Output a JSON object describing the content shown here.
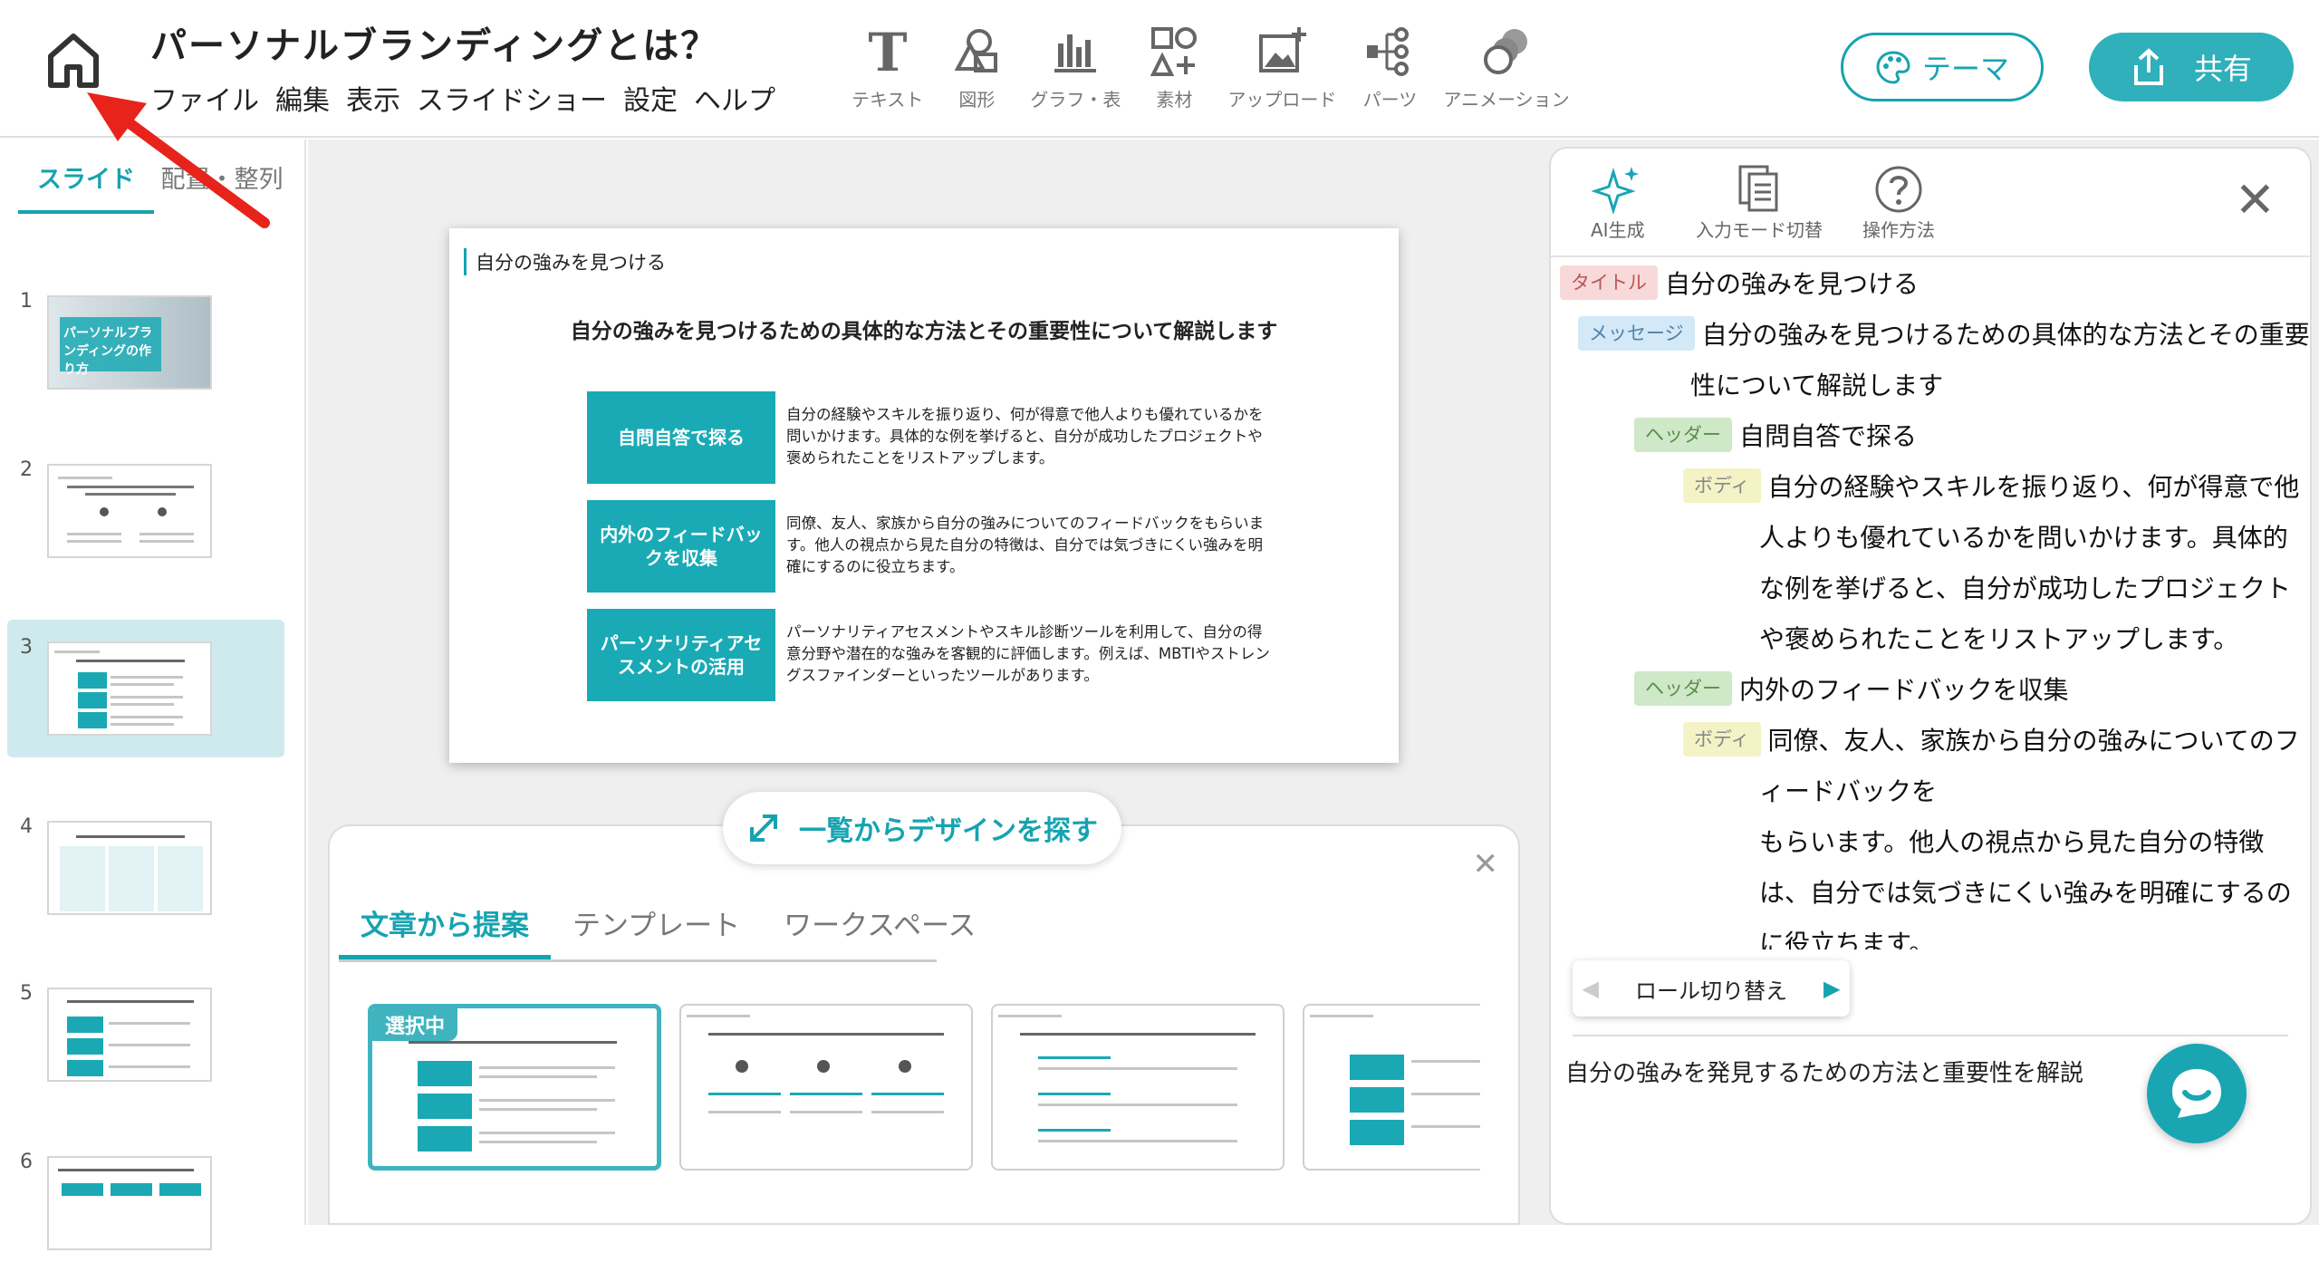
{
  "app": {
    "title": "パーソナルブランディングとは？",
    "menu": [
      "ファイル",
      "編集",
      "表示",
      "スライドショー",
      "設定",
      "ヘルプ"
    ]
  },
  "toolbar": {
    "tools": [
      {
        "label": "テキスト",
        "icon": "text-icon"
      },
      {
        "label": "図形",
        "icon": "shape-icon"
      },
      {
        "label": "グラフ・表",
        "icon": "chart-icon"
      },
      {
        "label": "素材",
        "icon": "material-icon"
      },
      {
        "label": "アップロード",
        "icon": "upload-icon"
      },
      {
        "label": "パーツ",
        "icon": "parts-icon"
      },
      {
        "label": "アニメーション",
        "icon": "animation-icon"
      }
    ],
    "theme_label": "テーマ",
    "share_label": "共有"
  },
  "sidebar": {
    "tabs": [
      "スライド",
      "配置・整列"
    ],
    "thumbs": [
      {
        "num": "1",
        "text": "パーソナルブランディングの作り方"
      },
      {
        "num": "2"
      },
      {
        "num": "3"
      },
      {
        "num": "4"
      },
      {
        "num": "5"
      },
      {
        "num": "6"
      }
    ]
  },
  "slide": {
    "title": "自分の強みを見つける",
    "message": "自分の強みを見つけるための具体的な方法とその重要性について解説します",
    "items": [
      {
        "header": "自問自答で探る",
        "body": "自分の経験やスキルを振り返り、何が得意で他人よりも優れているかを問いかけます。具体的な例を挙げると、自分が成功したプロジェクトや褒められたことをリストアップします。"
      },
      {
        "header": "内外のフィードバックを収集",
        "body": "同僚、友人、家族から自分の強みについてのフィードバックをもらいます。他人の視点から見た自分の特徴は、自分では気づきにくい強みを明確にするのに役立ちます。"
      },
      {
        "header": "パーソナリティアセスメントの活用",
        "body": "パーソナリティアセスメントやスキル診断ツールを利用して、自分の得意分野や潜在的な強みを客観的に評価します。例えば、MBTIやストレングスファインダーといったツールがあります。"
      }
    ]
  },
  "design_panel": {
    "find_label": "一覧からデザインを探す",
    "tabs": [
      "文章から提案",
      "テンプレート",
      "ワークスペース"
    ],
    "selected_badge": "選択中"
  },
  "right_panel": {
    "tools": [
      "AI生成",
      "入力モード切替",
      "操作方法"
    ],
    "roles": {
      "title": "タイトル",
      "message": "メッセージ",
      "header": "ヘッダー",
      "body": "ボディ"
    },
    "lines": {
      "title": "自分の強みを見つける",
      "msg1": "自分の強みを見つけるための具体的な方法とその重要",
      "msg2": "性について解説します",
      "h1": "自問自答で探る",
      "b1_1": "自分の経験やスキルを振り返り、何が得意で他",
      "b1_2": "人よりも優れているかを問いかけます。具体的",
      "b1_3": "な例を挙げると、自分が成功したプロジェクト",
      "b1_4": "や褒められたことをリストアップします。",
      "h2": "内外のフィードバックを収集",
      "b2_1": "同僚、友人、家族から自分の強みについてのフ",
      "b2_2": "ィードバックを",
      "b2_3": "もらいます。他人の視点から見た自分の特徴",
      "b2_4": "は、自分では気づきにくい強みを明確にするの",
      "b2_5": "に役立ちます。"
    },
    "roll_label": "ロール切り替え",
    "summary": "自分の強みを発見するための方法と重要性を解説"
  },
  "colors": {
    "accent": "#16a3b0",
    "slide_box": "#19aab5",
    "arrow": "#e8231b"
  }
}
